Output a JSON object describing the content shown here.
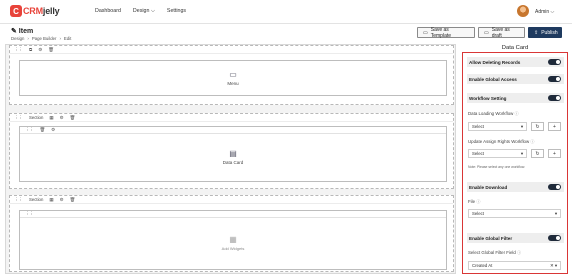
{
  "brand": {
    "mark": "C",
    "crm": "CRM",
    "jelly": "jelly"
  },
  "nav": {
    "items": [
      "Dashboard",
      "Design ⌵",
      "Settings"
    ]
  },
  "user": {
    "name": "Admin ⌵"
  },
  "page": {
    "title": "✎ Item",
    "breadcrumb": [
      "Design",
      "›",
      "Page Builder",
      "›",
      "Edit"
    ]
  },
  "actions": {
    "save_template": "Save as Template",
    "save_draft": "Save as draft",
    "publish": "Publish"
  },
  "canvas": {
    "sections": [
      {
        "label": "",
        "widget": "Menu",
        "widget_icon": "menu-widget-icon"
      },
      {
        "label": "Section",
        "widget": "Data Card",
        "widget_icon": "data-card-icon"
      },
      {
        "label": "Section",
        "widget": "Add Widgets",
        "widget_icon": "add-widget-icon"
      }
    ]
  },
  "panel": {
    "title": "Data Card",
    "allow_deleting": "Allow Deleting Records",
    "global_access": "Enable Global Access",
    "workflow_setting": "Workflow Setting",
    "data_loading_label": "Data Loading Workflow",
    "data_loading_value": "Select",
    "update_rights_label": "Update Assign Rights Workflow",
    "update_rights_value": "Select",
    "note": "Note: Please select any one workflow.",
    "enable_download": "Enable Download",
    "file_label": "File",
    "file_value": "Select",
    "global_filter": "Enable Global Filter",
    "filter_field_label": "Select Global Filter Field",
    "filter_field_value": "Created At",
    "toggles": {
      "allow_deleting": true,
      "global_access": true,
      "workflow_setting": true,
      "enable_download": true,
      "global_filter": true
    }
  },
  "colors": {
    "accent": "#1e3a5f",
    "brand": "#e8433a",
    "highlight_border": "#d93636"
  }
}
